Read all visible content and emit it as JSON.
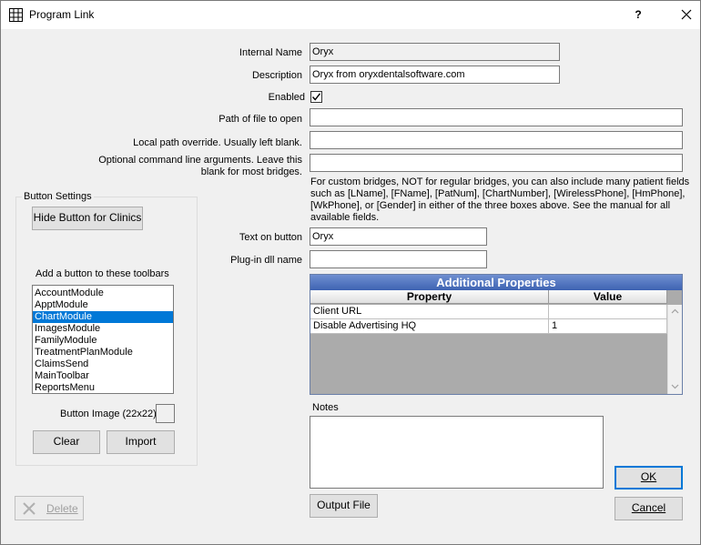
{
  "window": {
    "title": "Program Link",
    "help": "?"
  },
  "form": {
    "internal_name": {
      "label": "Internal Name",
      "value": "Oryx"
    },
    "description": {
      "label": "Description",
      "value": "Oryx from oryxdentalsoftware.com"
    },
    "enabled": {
      "label": "Enabled",
      "checked": true
    },
    "path": {
      "label": "Path of file to open",
      "value": ""
    },
    "local_path": {
      "label": "Local path override.  Usually left blank.",
      "value": ""
    },
    "cmdline": {
      "label_line1": "Optional command line arguments.  Leave this",
      "label_line2": "blank for most bridges.",
      "value": ""
    },
    "help_text": [
      "For custom bridges, NOT for regular bridges, you can also include many patient fields",
      "such as [LName], [FName], [PatNum], [ChartNumber], [WirelessPhone], [HmPhone],",
      "[WkPhone], or [Gender] in either of the three boxes above. See the manual for all",
      "available fields."
    ],
    "button_text": {
      "label": "Text on button",
      "value": "Oryx"
    },
    "plugin_dll": {
      "label": "Plug-in dll name",
      "value": ""
    }
  },
  "button_settings": {
    "title": "Button Settings",
    "hide_button": "Hide Button for Clinics",
    "toolbars_label": "Add a button to these toolbars",
    "toolbars": [
      "AccountModule",
      "ApptModule",
      "ChartModule",
      "ImagesModule",
      "FamilyModule",
      "TreatmentPlanModule",
      "ClaimsSend",
      "MainToolbar",
      "ReportsMenu"
    ],
    "selected_index": 2,
    "image_label": "Button Image (22x22)",
    "clear": "Clear",
    "import": "Import"
  },
  "properties": {
    "title": "Additional Properties",
    "col_property": "Property",
    "col_value": "Value",
    "rows": [
      {
        "property": "Client URL",
        "value": ""
      },
      {
        "property": "Disable Advertising HQ",
        "value": "1"
      }
    ]
  },
  "notes": {
    "label": "Notes",
    "value": ""
  },
  "buttons": {
    "delete": "Delete",
    "output_file": "Output File",
    "ok": "OK",
    "cancel": "Cancel"
  },
  "colors": {
    "selection": "#0078d7",
    "grid_title": "#4a6ec0"
  }
}
